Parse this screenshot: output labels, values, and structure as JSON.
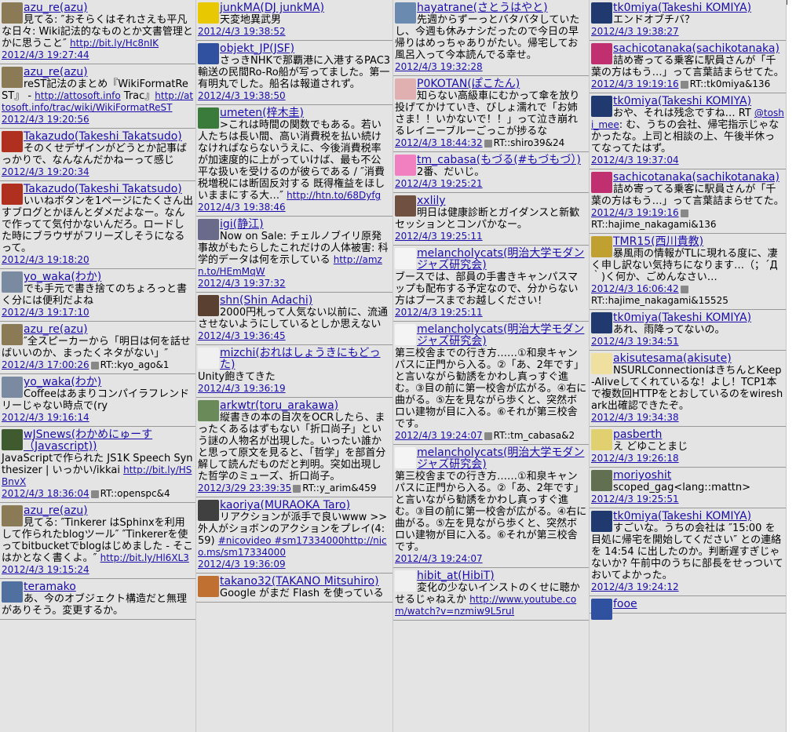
{
  "columns": [
    [
      {
        "user": "azu_re(azu)",
        "text": "見てる: ″おそらくはそれさえも平凡な日々: Wiki記法的なものとか文書管理とかに思うこと″ ",
        "url": "http://bit.ly/Hc8nIK",
        "time": "2012/4/3 19:27:44",
        "rt": "",
        "avatar": "#8a7a55"
      },
      {
        "user": "azu_re(azu)",
        "text": "reST記法のまとめ『WikiFormatReST』 - ",
        "url": "http://attosoft.info",
        "text2": " Trac』",
        "url2": "http://attosoft.info/trac/wiki/WikiFormatReST",
        "time": "2012/4/3 19:20:56",
        "rt": "",
        "avatar": "#8a7a55"
      },
      {
        "user": "Takazudo(Takeshi Takatsudo)",
        "text": "そのくせデザインがどうとか記事ばっかりで、なんなんだかねーって感じ",
        "url": "",
        "time": "2012/4/3 19:20:34",
        "rt": "",
        "avatar": "#b03020"
      },
      {
        "user": "Takazudo(Takeshi Takatsudo)",
        "text": "いいねボタンを1ページにたくさん出すブログとかほんとダメだよなー。なんで作ってて気付かないんだろ。ロードした時にブラウザがフリーズしそうになるって。",
        "url": "",
        "time": "2012/4/3 19:18:20",
        "rt": "",
        "avatar": "#b03020"
      },
      {
        "user": "yo_waka(わか)",
        "text": "でも手元で書き捨てのちょろっと書く分には便利だよね",
        "url": "",
        "time": "2012/4/3 19:17:10",
        "rt": "",
        "avatar": "#7a8aa0"
      },
      {
        "user": "azu_re(azu)",
        "text": "″全スピーカーから「明日は何を話せばいいのか、まったくネタがない」″",
        "url": "",
        "time": "2012/4/3 17:00:26",
        "rt": "RT::kyo_ago&1",
        "avatar": "#8a7a55"
      },
      {
        "user": "yo_waka(わか)",
        "text": "Coffeeはあまりコンパイラフレンドリーじゃない時点で(ry",
        "url": "",
        "time": "2012/4/3 19:16:14",
        "rt": "",
        "avatar": "#7a8aa0"
      },
      {
        "user": "wJSnews(わかめにゅーす（Javascript))",
        "text": "JavaScriptで作られた JS1K Speech Synthesizer | いっかい/ikkai ",
        "url": "http://bit.ly/HSBnvX",
        "time": "2012/4/3 18:36:04",
        "rt": "RT::openspc&4",
        "avatar": "#405a30"
      },
      {
        "user": "azu_re(azu)",
        "text": "見てる: ″Tinkerer はSphinxを利用して作られたblogツール″ ″Tinkererを使ってbitbucketでblogはじめました - そこはかとなく書くよ。″ ",
        "url": "http://bit.ly/Hl6XL3",
        "time": "2012/4/3 19:15:24",
        "rt": "",
        "avatar": "#8a7a55"
      },
      {
        "user": "teramako",
        "text": "あ、今のオブジェクト構造だと無理がありそう。変更するか。",
        "url": "",
        "time": "",
        "rt": "",
        "avatar": "#5070a0"
      }
    ],
    [
      {
        "user": "junkMA(DJ junkMA)",
        "text": "天変地異武男",
        "url": "",
        "time": "2012/4/3 19:38:52",
        "rt": "",
        "avatar": "#e8c800"
      },
      {
        "user": "objekt_JP(JSF)",
        "text": "さっきNHKで那覇港に入港するPAC3輸送の民間Ro-Ro船が写ってました。第一有明丸でした。船名は報道されず。",
        "url": "",
        "time": "2012/4/3 19:38:50",
        "rt": "",
        "avatar": "#3050a0"
      },
      {
        "user": "umeten(梓木圭)",
        "text": ">これは時間の関数でもある。若い人たちは長い間、高い消費税を払い続けなければならないうえに、今後消費税率が加速度的に上がっていけば、最も不公平な扱いを受けるのが彼らである / ″消費税増税には断固反対する 既得権益をほしいままにする大…″ ",
        "url": "http://htn.to/68Dyfg",
        "time": "2012/4/3 19:38:46",
        "rt": "",
        "avatar": "#3a7a3a"
      },
      {
        "user": "igi(静江)",
        "text": "Now on Sale: チェルノブイリ原発事故がもたらしたこれだけの人体被害: 科学的データは何を示している ",
        "url": "http://amzn.to/HEmMqW",
        "time": "2012/4/3 19:37:32",
        "rt": "",
        "avatar": "#6a6a8a"
      },
      {
        "user": "shn(Shin Adachi)",
        "text": "2000円札って人気ない以前に、流通させないようにしているとしか思えない",
        "url": "",
        "time": "2012/4/3 19:36:45",
        "rt": "",
        "avatar": "#5a4030"
      },
      {
        "user": "mizchi(おれはしょうきにもどった)",
        "text": "Unity飽きてきた",
        "url": "",
        "time": "2012/4/3 19:36:19",
        "rt": "",
        "avatar": "#f0f0f0"
      },
      {
        "user": "arkwtr(toru_arakawa)",
        "text": "縦書きの本の目次をOCRしたら、まったくあるはずもない「折口尚子」という謎の人物名が出現した。いったい誰かと思って原文を見ると、「哲学」を部首分解して読んだものだと判明。突如出現した哲学のミューズ、折口尚子。",
        "url": "",
        "time": "2012/3/29 23:39:35",
        "rt": "RT::y_arim&459",
        "avatar": "#6a8a5a"
      },
      {
        "user": "kaoriya(MURAOKA Taro)",
        "text": "リアクションが派手で良いwww >> 外人がショボンのアクションをプレイ(4:59) ",
        "url": "",
        "tags": "#nicovideo #sm17334000",
        "url2": "http://nico.ms/sm17334000",
        "time": "2012/4/3 19:36:09",
        "rt": "",
        "avatar": "#404040"
      },
      {
        "user": "takano32(TAKANO Mitsuhiro)",
        "text": "Google がまだ Flash を使っている",
        "url": "",
        "time": "",
        "rt": "",
        "avatar": "#c07030"
      }
    ],
    [
      {
        "user": "hayatrane(さとうはやと)",
        "text": "先週からずーっとバタバタしていたし、今週も休みナシだったので今日の早帰りはめっちゃありがたい。帰宅してお風呂入って今本読んでる幸せ。",
        "url": "",
        "time": "2012/4/3 19:32:28",
        "rt": "",
        "avatar": "#6a8ab0"
      },
      {
        "user": "P0KOTAN(ぽこたん)",
        "text": "知らない高級車にむかって傘を放り投げてかけていき、びしょ濡れで「お姉さま！！いかないで！！」って泣き崩れるレイニーブルーごっこが捗るな",
        "url": "",
        "time": "2012/4/3 18:44:32",
        "rt": "RT::shiro39&24",
        "avatar": "#e0b0b0"
      },
      {
        "user": "tm_cabasa(もづる(#もづもづ）)",
        "text": "2番、だいじ。",
        "url": "",
        "time": "2012/4/3 19:25:21",
        "rt": "",
        "avatar": "#f080c0"
      },
      {
        "user": "xxlily",
        "text": "明日は健康診断とガイダンスと新歓セッションとコンパかなー。",
        "url": "",
        "time": "2012/4/3 19:25:11",
        "rt": "",
        "avatar": "#705040"
      },
      {
        "user": "melancholycats(明治大学モダンジャズ研究会)",
        "text": "ブースでは、部員の手書きキャンパスマップも配布する予定なので、分からない方はブースまでお越しください！",
        "url": "",
        "time": "2012/4/3 19:25:11",
        "rt": "",
        "avatar": "#f4f4f4"
      },
      {
        "user": "melancholycats(明治大学モダンジャズ研究会)",
        "text": "第三校舎までの行き方……①和泉キャンパスに正門から入る。②「あ、2年です」と言いながら勧誘をかわし真っすぐ進む。③目の前に第一校舎が広がる。④右に曲がる。⑤左を見ながら歩くと、突然ボロい建物が目に入る。⑥それが第三校舎です。",
        "url": "",
        "time": "2012/4/3 19:24:07",
        "rt": "RT::tm_cabasa&2",
        "avatar": "#f4f4f4"
      },
      {
        "user": "melancholycats(明治大学モダンジャズ研究会)",
        "text": "第三校舎までの行き方……①和泉キャンパスに正門から入る。②「あ、2年です」と言いながら勧誘をかわし真っすぐ進む。③目の前に第一校舎が広がる。④右に曲がる。⑤左を見ながら歩くと、突然ボロい建物が目に入る。⑥それが第三校舎です。",
        "url": "",
        "time": "2012/4/3 19:24:07",
        "rt": "",
        "avatar": "#f4f4f4"
      },
      {
        "user": "hibit_at(HibiT)",
        "text": "変化の少ないインストのくせに聴かせるじゃねえか ",
        "url": "http://www.youtube.com/watch?v=nzmiw9L5ruI",
        "time": "",
        "rt": "",
        "avatar": "#f0f0f0"
      }
    ],
    [
      {
        "user": "tk0miya(Takeshi KOMIYA)",
        "text": "エンドオブチバ？",
        "url": "",
        "time": "2012/4/3 19:38:27",
        "rt": "",
        "avatar": "#203a70"
      },
      {
        "user": "sachicotanaka(sachikotanaka)",
        "text": "詰め寄ってる乗客に駅員さんが「千葉の方はもう…」って言葉詰まらせてた。",
        "url": "",
        "time": "2012/4/3 19:19:16",
        "rt": "RT::tk0miya&136",
        "avatar": "#c03070"
      },
      {
        "user": "tk0miya(Takeshi KOMIYA)",
        "text": "おや、それは残念ですね… RT ",
        "mention": "@toshi_mee",
        "text2": ": む、うちの会社、帰宅指示じゃなかったな。上司と相談の上、午後半休ってなってたはず。",
        "url": "",
        "time": "2012/4/3 19:37:04",
        "rt": "",
        "avatar": "#203a70"
      },
      {
        "user": "sachicotanaka(sachikotanaka)",
        "text": "詰め寄ってる乗客に駅員さんが「千葉の方はもう…」って言葉詰まらせてた。",
        "url": "",
        "time": "2012/4/3 19:19:16",
        "rt": "RT::hajime_nakagami&136",
        "avatar": "#c03070"
      },
      {
        "user": "TMR15(西川貴教)",
        "text": "暴風雨の情報がTLに現れる度に、凄く申し訳ない気持ちになります…（；´Д｀)く何か、ごめんなさい…",
        "url": "",
        "time": "2012/4/3 16:06:42",
        "rt": "RT::hajime_nakagami&15525",
        "avatar": "#c0a030"
      },
      {
        "user": "tk0miya(Takeshi KOMIYA)",
        "text": "あれ、雨降ってないの。",
        "url": "",
        "time": "2012/4/3 19:34:51",
        "rt": "",
        "avatar": "#203a70"
      },
      {
        "user": "akisutesama(akisute)",
        "text": "NSURLConnectionはきちんとKeep-Aliveしてくれているな！よし！TCP1本で複数回HTTPをとおしているのをwireshark出確認できたぞ。",
        "url": "",
        "time": "2012/4/3 19:34:38",
        "rt": "",
        "avatar": "#f0e0a0"
      },
      {
        "user": "pasberth",
        "text": "え どゆことまじ",
        "url": "",
        "time": "2012/4/3 19:26:18",
        "rt": "",
        "avatar": "#e0d070"
      },
      {
        "user": "moriyoshit",
        "text": "scoped_gag<lang::mattn>",
        "url": "",
        "time": "2012/4/3 19:25:51",
        "rt": "",
        "avatar": "#607050"
      },
      {
        "user": "tk0miya(Takeshi KOMIYA)",
        "text": "すごいな。うちの会社は ″15:00 を目処に帰宅を開始してください″ との連絡を 14:54 に出したのか。判断遅すぎじゃないか? 午前中のうちに部長をせっついておいてよかった。",
        "url": "",
        "time": "2012/4/3 19:24:12",
        "rt": "",
        "avatar": "#203a70"
      },
      {
        "user": "fooe",
        "text": "",
        "url": "",
        "time": "",
        "rt": "",
        "avatar": "#3050a0"
      }
    ]
  ]
}
